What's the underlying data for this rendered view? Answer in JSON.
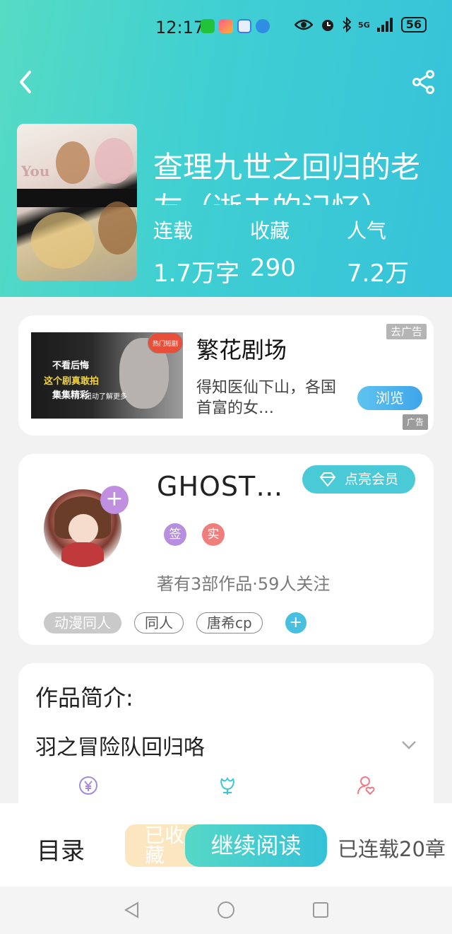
{
  "status_bar": {
    "time": "12:17",
    "battery": "56",
    "network": "5G"
  },
  "book": {
    "title": "查理九世之回归的老友（逝去的记忆）",
    "stats": [
      {
        "label": "连载",
        "value": "1.7万字"
      },
      {
        "label": "收藏",
        "value": "290"
      },
      {
        "label": "人气",
        "value": "7.2万"
      }
    ],
    "cover_text": "You"
  },
  "ad": {
    "title": "繁花剧场",
    "description": "得知医仙下山，各国首富的女…",
    "close_label": "去广告",
    "browse_label": "浏览",
    "badge_label": "广告",
    "image_tag": "热门短剧",
    "image_lines": [
      "不看后悔",
      "这个剧真敢拍",
      "集集精彩",
      "扭动了解更多"
    ]
  },
  "author": {
    "name": "GHOST…",
    "vip_label": "点亮会员",
    "badge_sign": "签",
    "badge_real": "实",
    "meta": "著有3部作品·59人关注",
    "tags": [
      "动漫同人",
      "同人",
      "唐希cp"
    ],
    "follow_symbol": "+"
  },
  "intro": {
    "heading": "作品简介:",
    "text": "羽之冒险队回归咯"
  },
  "bottom_bar": {
    "toc_label": "目录",
    "favorite_label": "已收藏",
    "continue_label": "继续阅读",
    "serial_info": "已连载20章"
  },
  "colors": {
    "header_start": "#56dbc4",
    "header_end": "#36c2da",
    "accent": "#4ac9d6",
    "favorite_bg": "#fbe6bf"
  }
}
